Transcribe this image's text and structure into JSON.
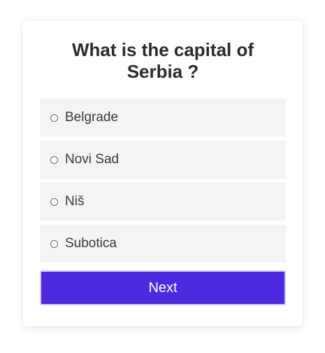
{
  "quiz": {
    "question": "What is the capital of Serbia ?",
    "options": [
      {
        "label": "Belgrade",
        "selected": false
      },
      {
        "label": "Novi Sad",
        "selected": false
      },
      {
        "label": "Niš",
        "selected": false
      },
      {
        "label": "Subotica",
        "selected": false
      }
    ],
    "next_label": "Next"
  },
  "colors": {
    "accent": "#4d2ae0",
    "option_background": "#f4f4f4",
    "question_text": "#2b2b2b"
  },
  "icons": {
    "option_marker": "radio-unchecked-icon"
  }
}
